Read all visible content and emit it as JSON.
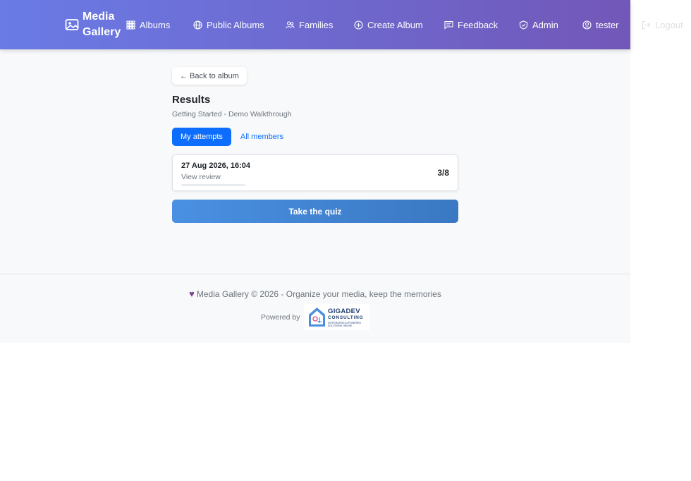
{
  "navbar": {
    "brand": "Media Gallery",
    "items": [
      {
        "label": "Albums",
        "icon": "grid-icon"
      },
      {
        "label": "Public Albums",
        "icon": "globe-icon"
      },
      {
        "label": "Families",
        "icon": "people-icon"
      },
      {
        "label": "Create Album",
        "icon": "plus-circle-icon"
      },
      {
        "label": "Feedback",
        "icon": "chat-icon"
      },
      {
        "label": "Admin",
        "icon": "shield-icon"
      },
      {
        "label": "tester",
        "icon": "user-circle-icon"
      },
      {
        "label": "Logout",
        "icon": "logout-icon"
      }
    ]
  },
  "main": {
    "back_label": "← Back to album",
    "title": "Results",
    "subtitle": "Getting Started - Demo Walkthrough",
    "tabs": [
      {
        "label": "My attempts",
        "active": true
      },
      {
        "label": "All members",
        "active": false
      }
    ],
    "attempts": [
      {
        "date": "27 Aug 2026, 16:04",
        "link": "View review",
        "score": "3/8",
        "progress": 0.375
      }
    ],
    "quiz_button": "Take the quiz"
  },
  "footer": {
    "text": "Media Gallery © 2026 - Organize your media, keep the memories",
    "powered_by": "Powered by",
    "logo": {
      "main": "GIGADEV",
      "sub": "CONSULTING",
      "tagline": "INTEGRATING AI-POWERED SOLUTIONS ONLINE"
    }
  },
  "colors": {
    "nav_start": "#6a7be6",
    "nav_end": "#7257b8",
    "accent": "#0d6efd",
    "quiz_button": "#4a90e2",
    "heart": "#7b3f8c"
  }
}
